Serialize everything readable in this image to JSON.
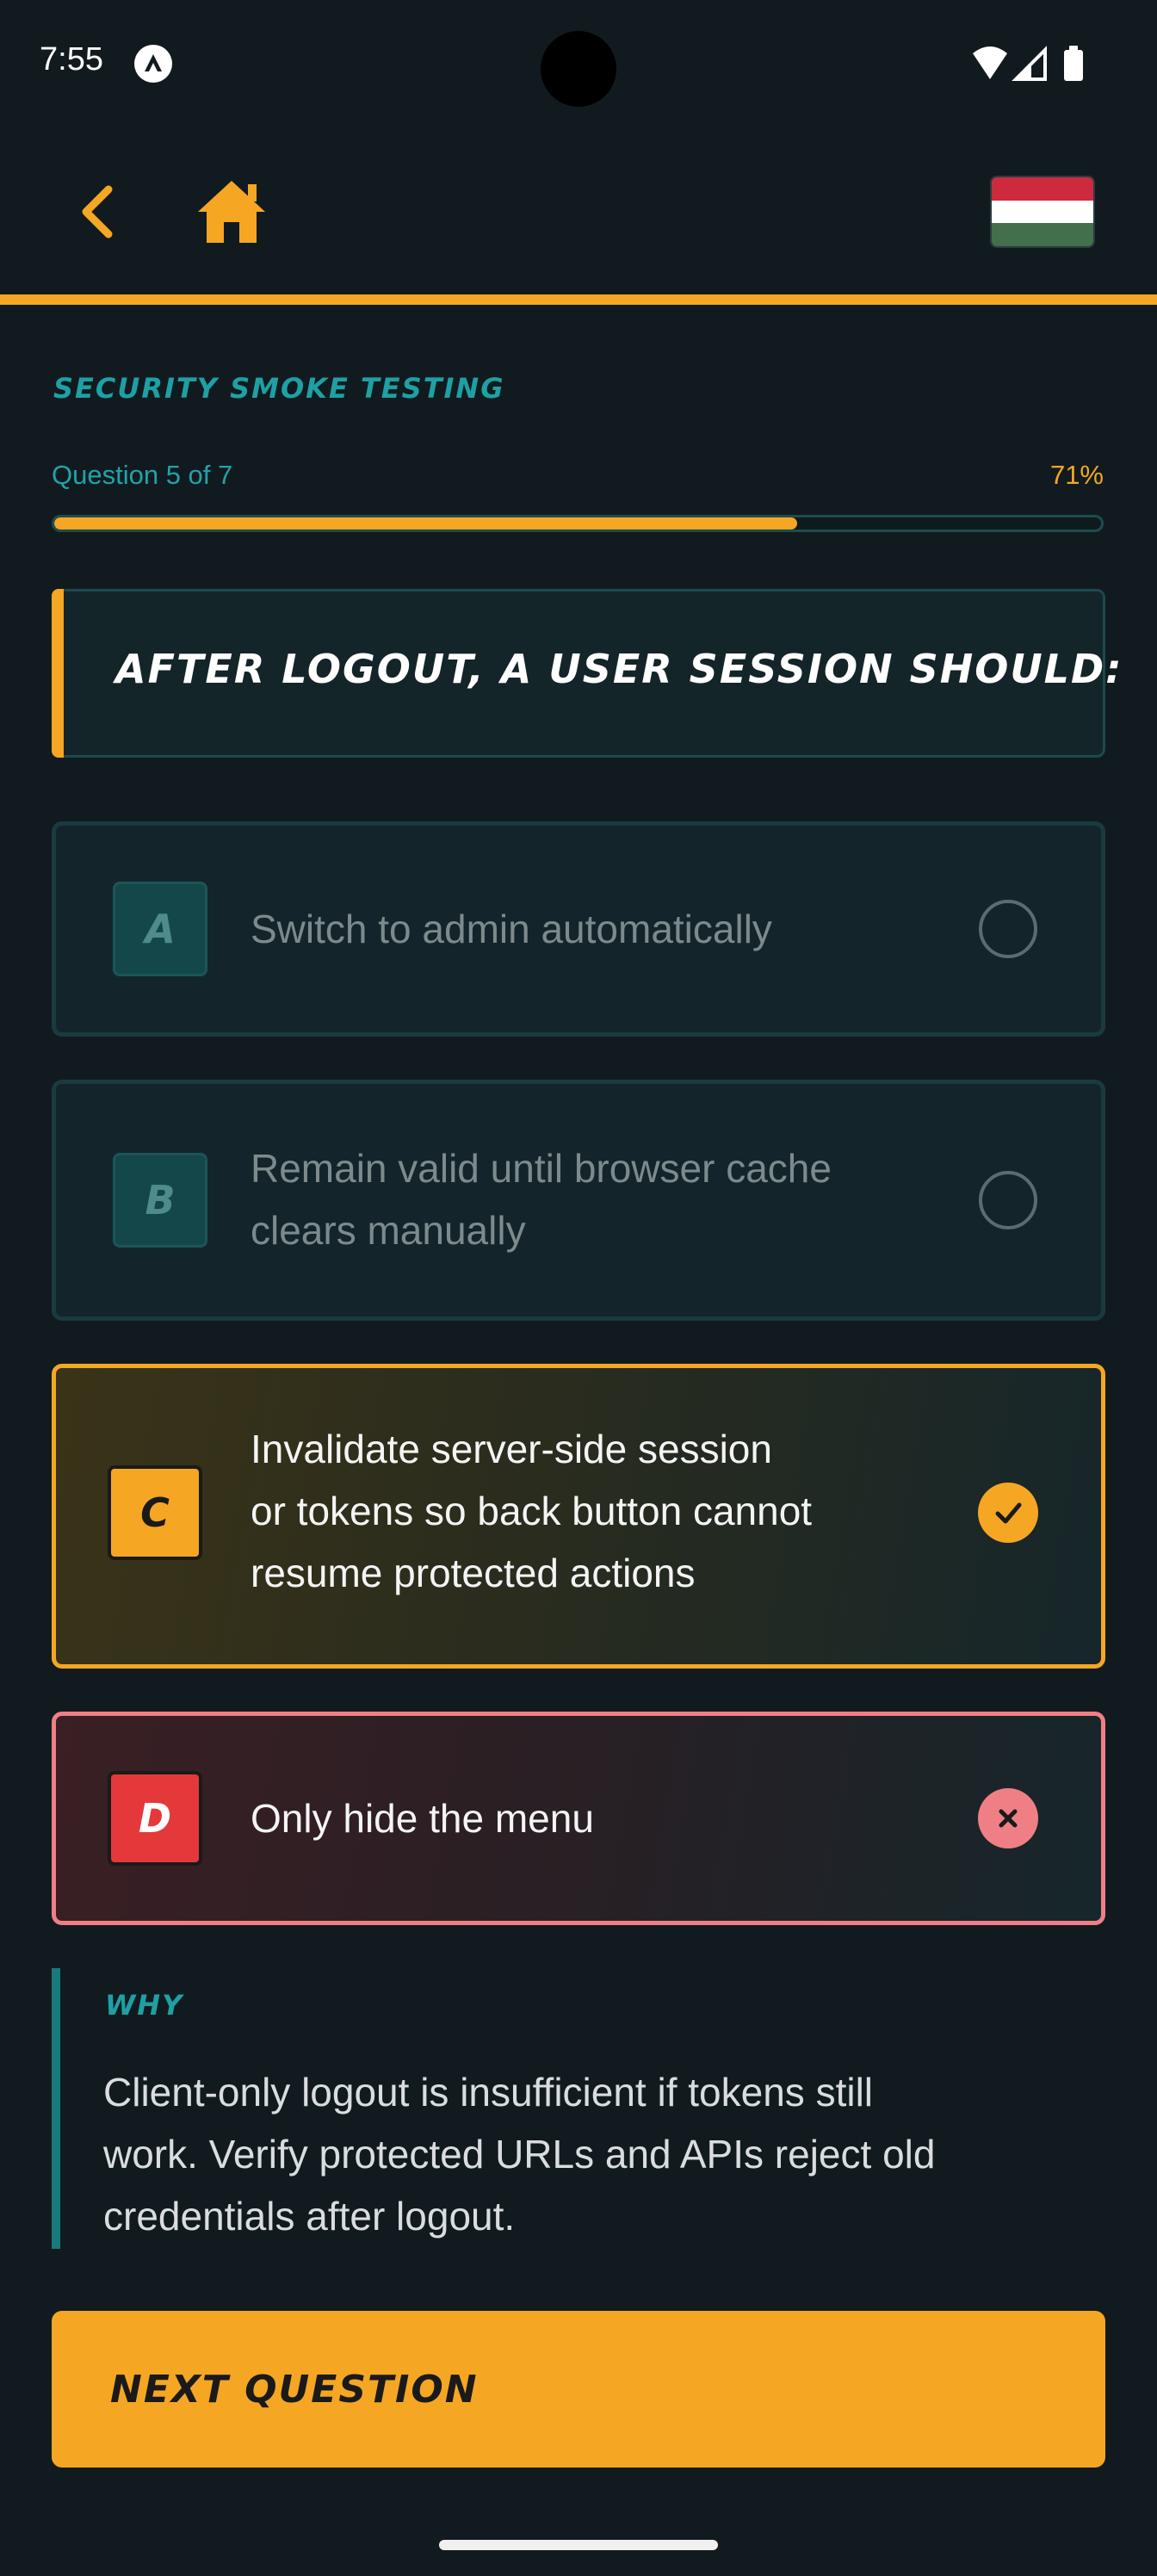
{
  "status_bar": {
    "time": "7:55"
  },
  "top_bar": {
    "back_icon": "chevron-left-icon",
    "home_icon": "home-icon",
    "flag_colors": [
      "#cd2a3e",
      "#ffffff",
      "#436f4d"
    ]
  },
  "quiz": {
    "category": "SECURITY SMOKE TESTING",
    "progress_label": "Question 5 of 7",
    "progress_percent_label": "71%",
    "progress": 0.71,
    "question": "AFTER LOGOUT, A USER SESSION SHOULD:"
  },
  "options": [
    {
      "letter": "A",
      "lines": [
        "Switch to admin automatically"
      ],
      "state": "unselected"
    },
    {
      "letter": "B",
      "lines": [
        "Remain valid until browser cache",
        "clears manually"
      ],
      "state": "unselected"
    },
    {
      "letter": "C",
      "lines": [
        "Invalidate server-side session",
        "or tokens so back button cannot",
        "resume protected actions"
      ],
      "state": "correct"
    },
    {
      "letter": "D",
      "lines": [
        "Only hide the menu"
      ],
      "state": "wrong"
    }
  ],
  "why": {
    "title": "WHY",
    "lines": [
      "Client-only logout is insufficient if tokens still",
      "work. Verify protected URLs and APIs reject old",
      "credentials after logout."
    ]
  },
  "next_button": {
    "label": "NEXT QUESTION"
  },
  "colors": {
    "accent": "#f5a623",
    "teal": "#1ea0a4",
    "wrong": "#f07f85",
    "background": "#111b1f"
  }
}
